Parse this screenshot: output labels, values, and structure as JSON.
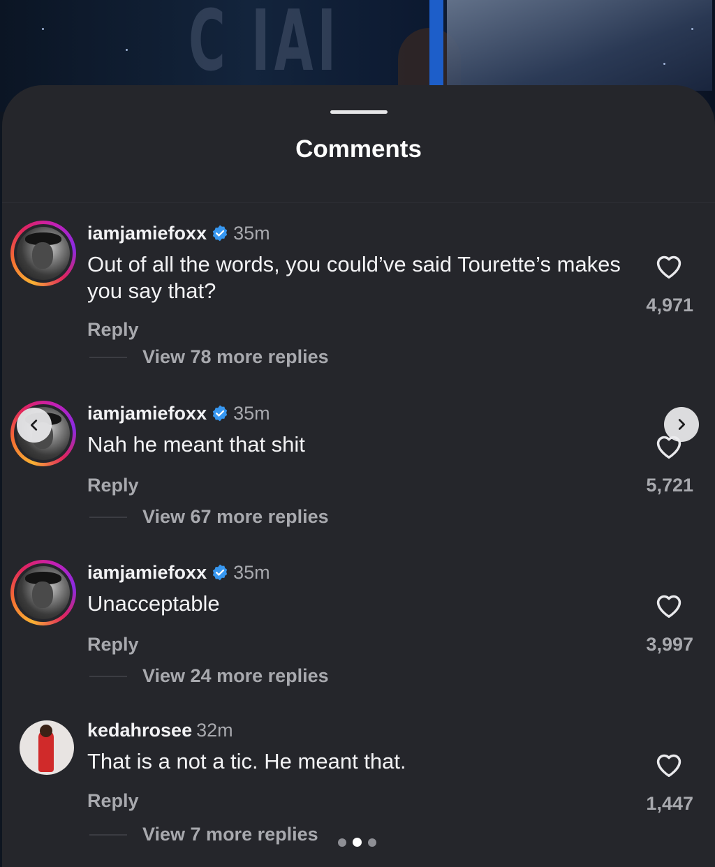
{
  "sheet": {
    "title": "Comments"
  },
  "comments": [
    {
      "username": "iamjamiefoxx",
      "verified": true,
      "time": "35m",
      "text": "Out of all the words, you could’ve said Tourette’s makes you say that?",
      "reply_label": "Reply",
      "view_replies": "View 78 more replies",
      "likes": "4,971"
    },
    {
      "username": "iamjamiefoxx",
      "verified": true,
      "time": "35m",
      "text": "Nah he meant that shit",
      "reply_label": "Reply",
      "view_replies": "View 67 more replies",
      "likes": "5,721"
    },
    {
      "username": "iamjamiefoxx",
      "verified": true,
      "time": "35m",
      "text": "Unacceptable",
      "reply_label": "Reply",
      "view_replies": "View 24 more replies",
      "likes": "3,997"
    },
    {
      "username": "kedahrosee",
      "verified": false,
      "time": "32m",
      "text": "That is a not a tic. He meant that.",
      "reply_label": "Reply",
      "view_replies": "View 7 more replies",
      "likes": "1,447"
    }
  ],
  "carousel": {
    "prev_icon": "chevron-left-icon",
    "next_icon": "chevron-right-icon",
    "page_count": 3,
    "active_page": 2
  },
  "colors": {
    "sheet_background": "#25262b",
    "primary_text": "#f2f2f4",
    "secondary_text": "#a8a9ae",
    "verified_blue": "#3797f0"
  }
}
